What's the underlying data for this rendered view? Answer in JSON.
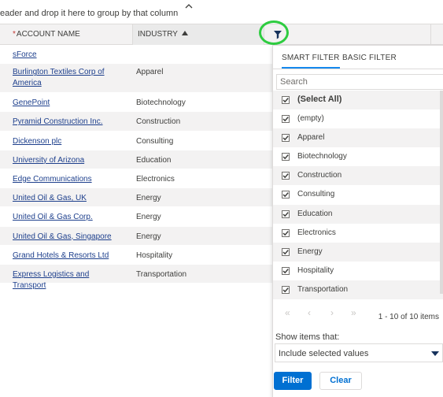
{
  "group_panel": {
    "hint": "eader and drop it here to group by that column"
  },
  "header": {
    "account_required": "*",
    "account_label": "ACCOUNT NAME",
    "industry_label": "INDUSTRY"
  },
  "rows": [
    {
      "account": "sForce",
      "industry": ""
    },
    {
      "account": "Burlington Textiles Corp of America",
      "industry": "Apparel"
    },
    {
      "account": "GenePoint",
      "industry": "Biotechnology"
    },
    {
      "account": "Pyramid Construction Inc.",
      "industry": "Construction"
    },
    {
      "account": "Dickenson plc",
      "industry": "Consulting"
    },
    {
      "account": "University of Arizona",
      "industry": "Education"
    },
    {
      "account": "Edge Communications",
      "industry": "Electronics"
    },
    {
      "account": "United Oil & Gas, UK",
      "industry": "Energy"
    },
    {
      "account": "United Oil & Gas Corp.",
      "industry": "Energy"
    },
    {
      "account": "United Oil & Gas, Singapore",
      "industry": "Energy"
    },
    {
      "account": "Grand Hotels & Resorts Ltd",
      "industry": "Hospitality"
    },
    {
      "account": "Express Logistics and Transport",
      "industry": "Transportation"
    }
  ],
  "filter_popup": {
    "tabs": [
      "SMART FILTER",
      "BASIC FILTER"
    ],
    "search_placeholder": "Search",
    "options": [
      {
        "label": "(Select All)",
        "checked": true
      },
      {
        "label": "(empty)",
        "checked": true
      },
      {
        "label": "Apparel",
        "checked": true
      },
      {
        "label": "Biotechnology",
        "checked": true
      },
      {
        "label": "Construction",
        "checked": true
      },
      {
        "label": "Consulting",
        "checked": true
      },
      {
        "label": "Education",
        "checked": true
      },
      {
        "label": "Electronics",
        "checked": true
      },
      {
        "label": "Energy",
        "checked": true
      },
      {
        "label": "Hospitality",
        "checked": true
      },
      {
        "label": "Transportation",
        "checked": true
      }
    ],
    "pager_info": "1 - 10 of 10 items",
    "show_items_label": "Show items that:",
    "condition_value": "Include selected values",
    "filter_button": "Filter",
    "clear_button": "Clear"
  },
  "colors": {
    "link": "#1d3f8c",
    "primary_button": "#0070d2",
    "highlight_ring": "#2ecc40",
    "active_tab": "#1589ee",
    "alt_row": "#f3f2f2"
  },
  "icons": {
    "collapse": "chevron-up-icon",
    "sort": "sort-ascending-icon",
    "filter": "funnel-filter-icon",
    "checkbox": "checkbox-checked-icon",
    "pager": [
      "first-page-icon",
      "prev-page-icon",
      "next-page-icon",
      "last-page-icon"
    ],
    "dropdown": "caret-down-icon"
  }
}
